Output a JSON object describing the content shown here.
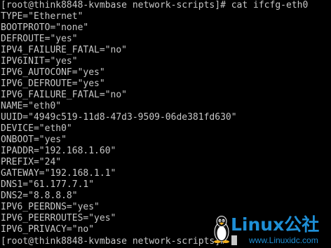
{
  "terminal": {
    "lines": [
      "[root@think8848-kvmbase network-scripts]# cat ifcfg-eth0",
      "TYPE=\"Ethernet\"",
      "BOOTPROTO=\"none\"",
      "DEFROUTE=\"yes\"",
      "IPV4_FAILURE_FATAL=\"no\"",
      "IPV6INIT=\"yes\"",
      "IPV6_AUTOCONF=\"yes\"",
      "IPV6_DEFROUTE=\"yes\"",
      "IPV6_FAILURE_FATAL=\"no\"",
      "NAME=\"eth0\"",
      "UUID=\"4949c519-11d8-47d3-9509-06de381fd630\"",
      "DEVICE=\"eth0\"",
      "ONBOOT=\"yes\"",
      "IPADDR=\"192.168.1.60\"",
      "PREFIX=\"24\"",
      "GATEWAY=\"192.168.1.1\"",
      "DNS1=\"61.177.7.1\"",
      "DNS2=\"8.8.8.8\"",
      "IPV6_PEERDNS=\"yes\"",
      "IPV6_PEERROUTES=\"yes\"",
      "IPV6_PRIVACY=\"no\""
    ],
    "prompt_last": "[root@think8848-kvmbase network-scripts]# "
  },
  "watermark": {
    "brand": "Linux公社",
    "url": "www.Linuxidc.com"
  },
  "colors": {
    "background": "#000000",
    "text": "#c7c7c7",
    "watermark": "#1e8fd6"
  }
}
